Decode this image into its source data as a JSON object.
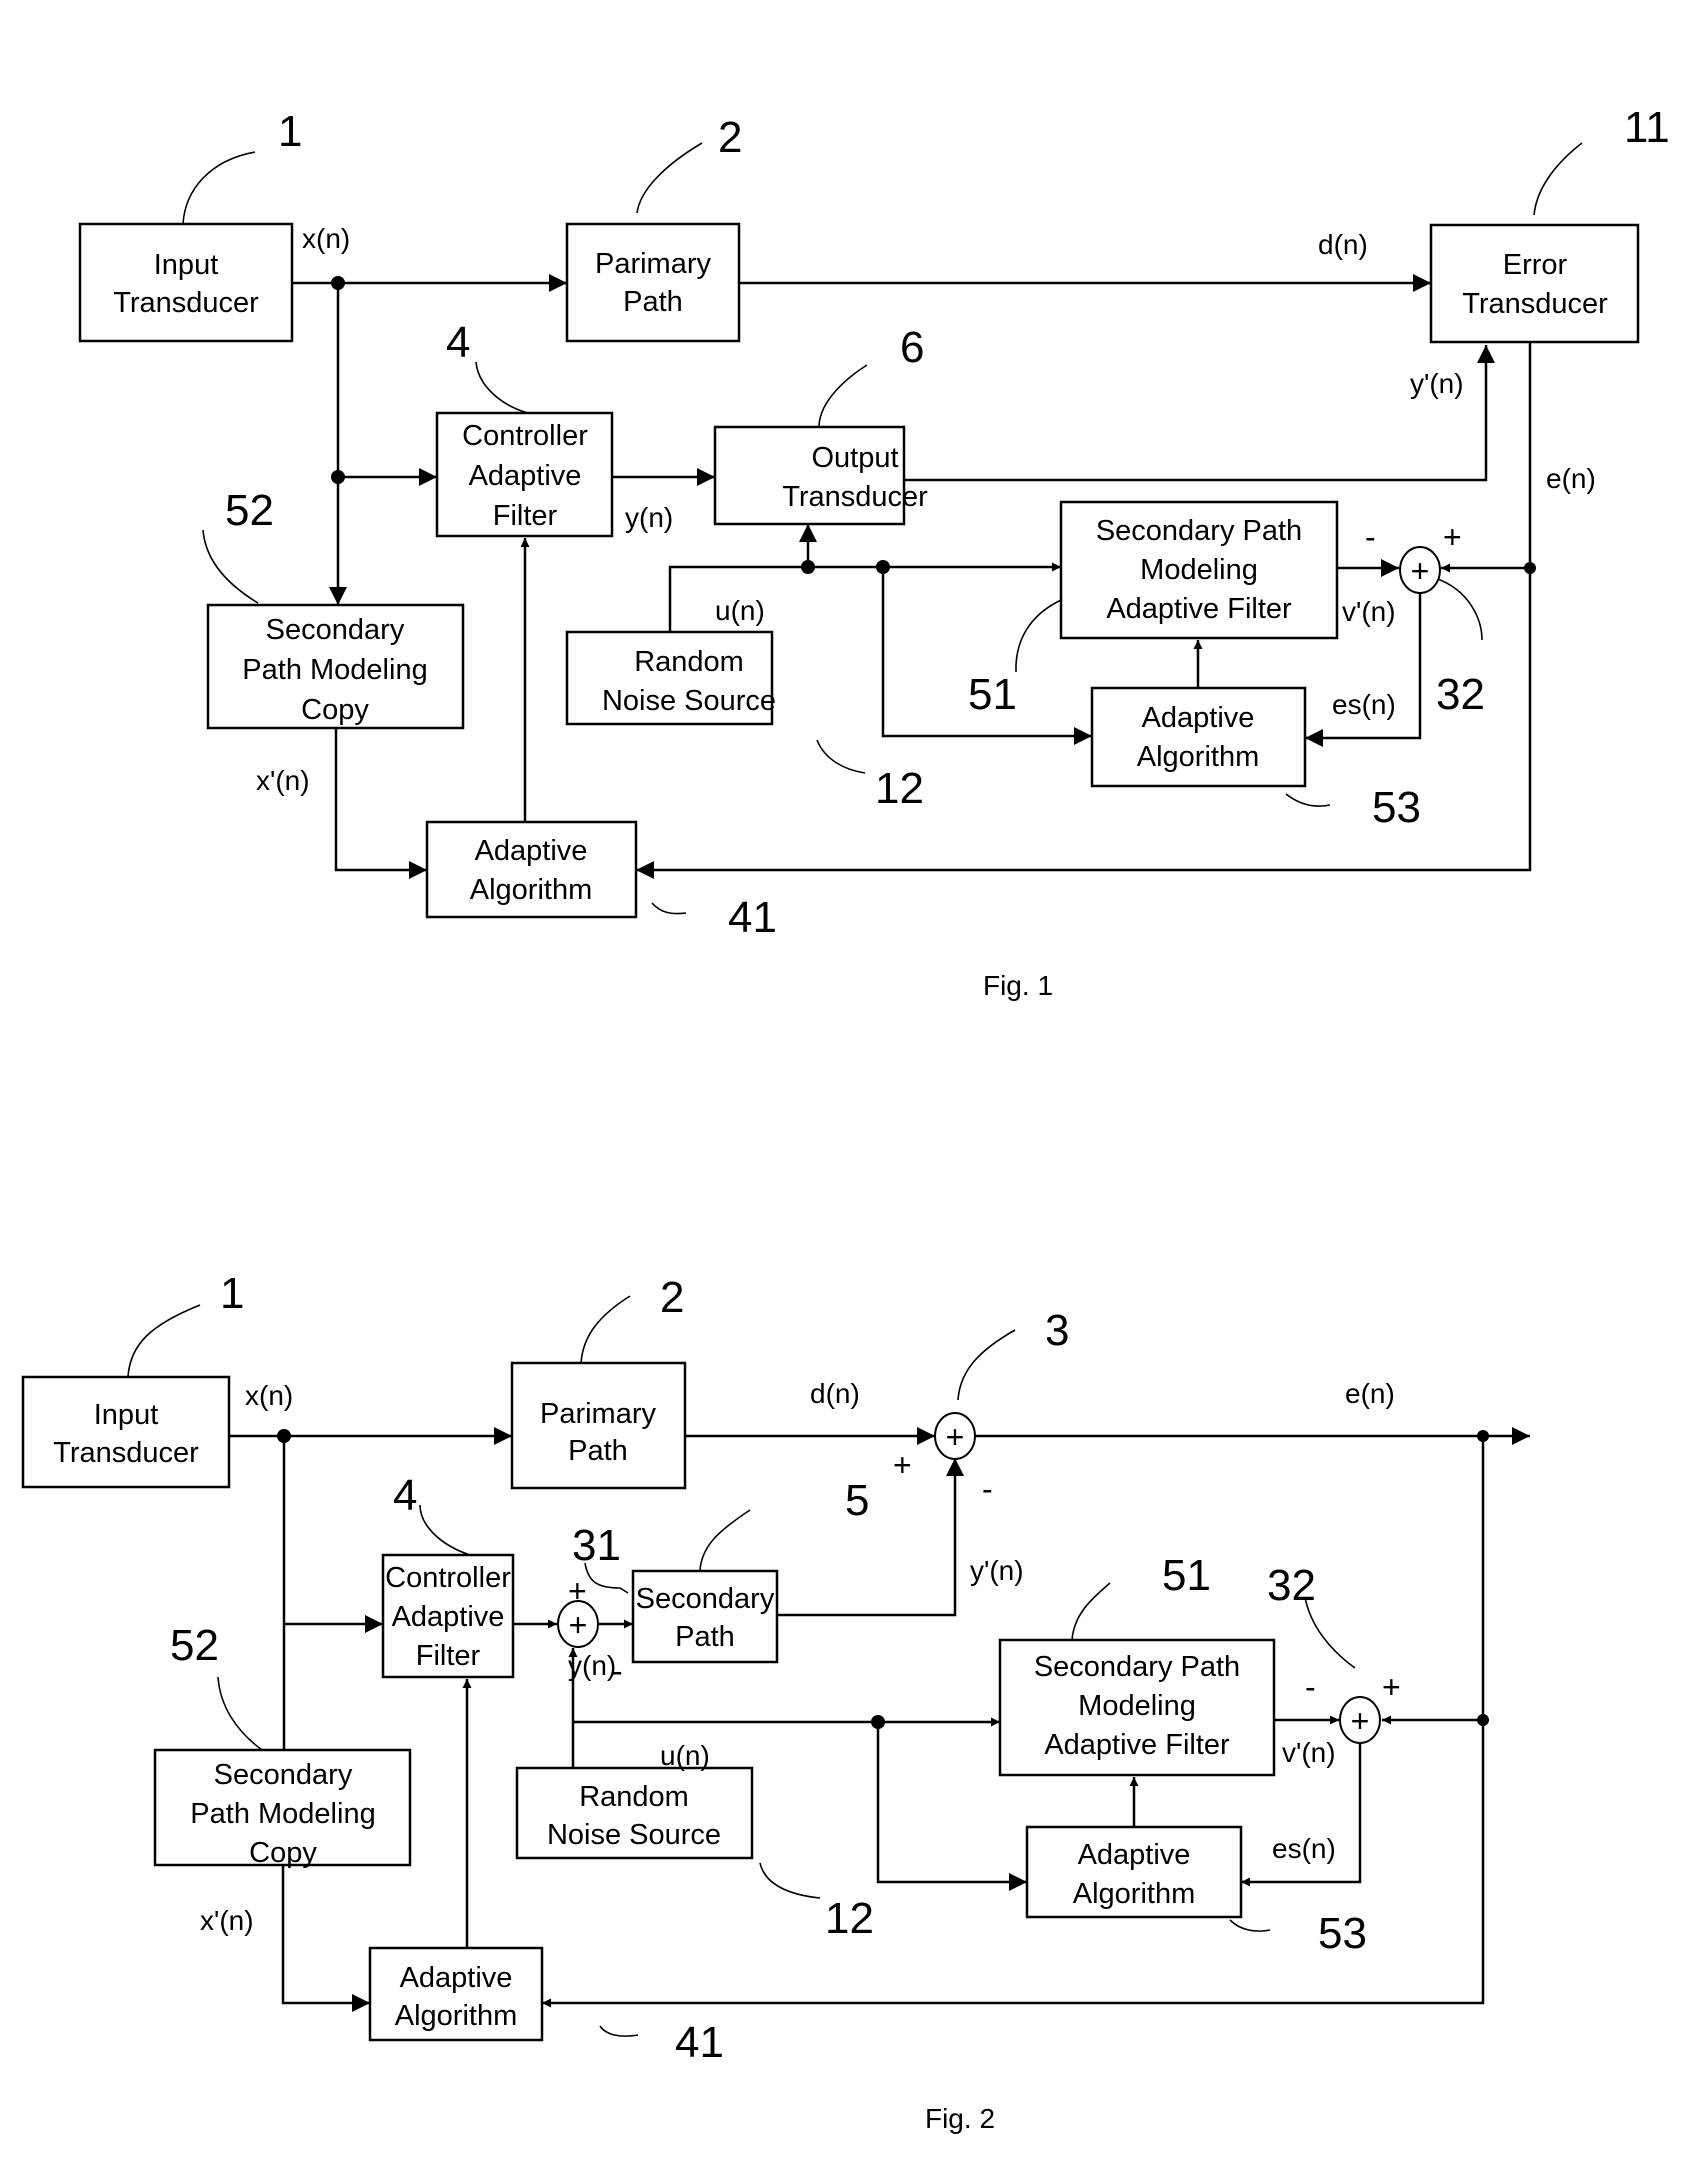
{
  "fig1": {
    "caption": "Fig. 1",
    "blocks": {
      "input_transducer": [
        "Input",
        "Transducer"
      ],
      "primary_path": [
        "Parimary",
        "Path"
      ],
      "error_transducer": [
        "Error",
        "Transducer"
      ],
      "controller_adaptive_filter": [
        "Controller",
        "Adaptive",
        "Filter"
      ],
      "output_transducer": [
        "Output",
        "Transducer"
      ],
      "secondary_path_modeling_adaptive_filter": [
        "Secondary Path",
        "Modeling",
        "Adaptive Filter"
      ],
      "secondary_path_modeling_copy": [
        "Secondary",
        "Path Modeling",
        "Copy"
      ],
      "random_noise_source": [
        "Random",
        "Noise Source"
      ],
      "adaptive_algorithm_53": [
        "Adaptive",
        "Algorithm"
      ],
      "adaptive_algorithm_41": [
        "Adaptive",
        "Algorithm"
      ]
    },
    "signals": {
      "x": "x(n)",
      "d": "d(n)",
      "y": "y(n)",
      "y_prime": "y'(n)",
      "e": "e(n)",
      "u": "u(n)",
      "v_prime": "v'(n)",
      "es": "es(n)",
      "x_prime": "x'(n)"
    },
    "refs": {
      "r1": "1",
      "r2": "2",
      "r11": "11",
      "r4": "4",
      "r6": "6",
      "r52": "52",
      "r51": "51",
      "r32": "32",
      "r12": "12",
      "r53": "53",
      "r41": "41"
    },
    "signs": {
      "sum32_minus": "-",
      "sum32_plus": "+",
      "sum_symbol": "+"
    }
  },
  "fig2": {
    "caption": "Fig. 2",
    "blocks": {
      "input_transducer": [
        "Input",
        "Transducer"
      ],
      "primary_path": [
        "Parimary",
        "Path"
      ],
      "controller_adaptive_filter": [
        "Controller",
        "Adaptive",
        "Filter"
      ],
      "secondary_path": [
        "Secondary",
        "Path"
      ],
      "secondary_path_modeling_adaptive_filter": [
        "Secondary Path",
        "Modeling",
        "Adaptive Filter"
      ],
      "secondary_path_modeling_copy": [
        "Secondary",
        "Path Modeling",
        "Copy"
      ],
      "random_noise_source": [
        "Random",
        "Noise Source"
      ],
      "adaptive_algorithm_53": [
        "Adaptive",
        "Algorithm"
      ],
      "adaptive_algorithm_41": [
        "Adaptive",
        "Algorithm"
      ]
    },
    "signals": {
      "x": "x(n)",
      "d": "d(n)",
      "e": "e(n)",
      "y": "y(n)",
      "y_prime": "y'(n)",
      "u": "u(n)",
      "v_prime": "v'(n)",
      "es": "es(n)",
      "x_prime": "x'(n)"
    },
    "refs": {
      "r1": "1",
      "r2": "2",
      "r3": "3",
      "r4": "4",
      "r31": "31",
      "r5": "5",
      "r51": "51",
      "r32": "32",
      "r52": "52",
      "r12": "12",
      "r53": "53",
      "r41": "41"
    },
    "signs": {
      "sum3_plus": "+",
      "sum3_minus": "-",
      "sum31_plus": "+",
      "sum31_minus": "-",
      "sum32_minus": "-",
      "sum32_plus": "+",
      "sum_symbol": "+"
    }
  }
}
